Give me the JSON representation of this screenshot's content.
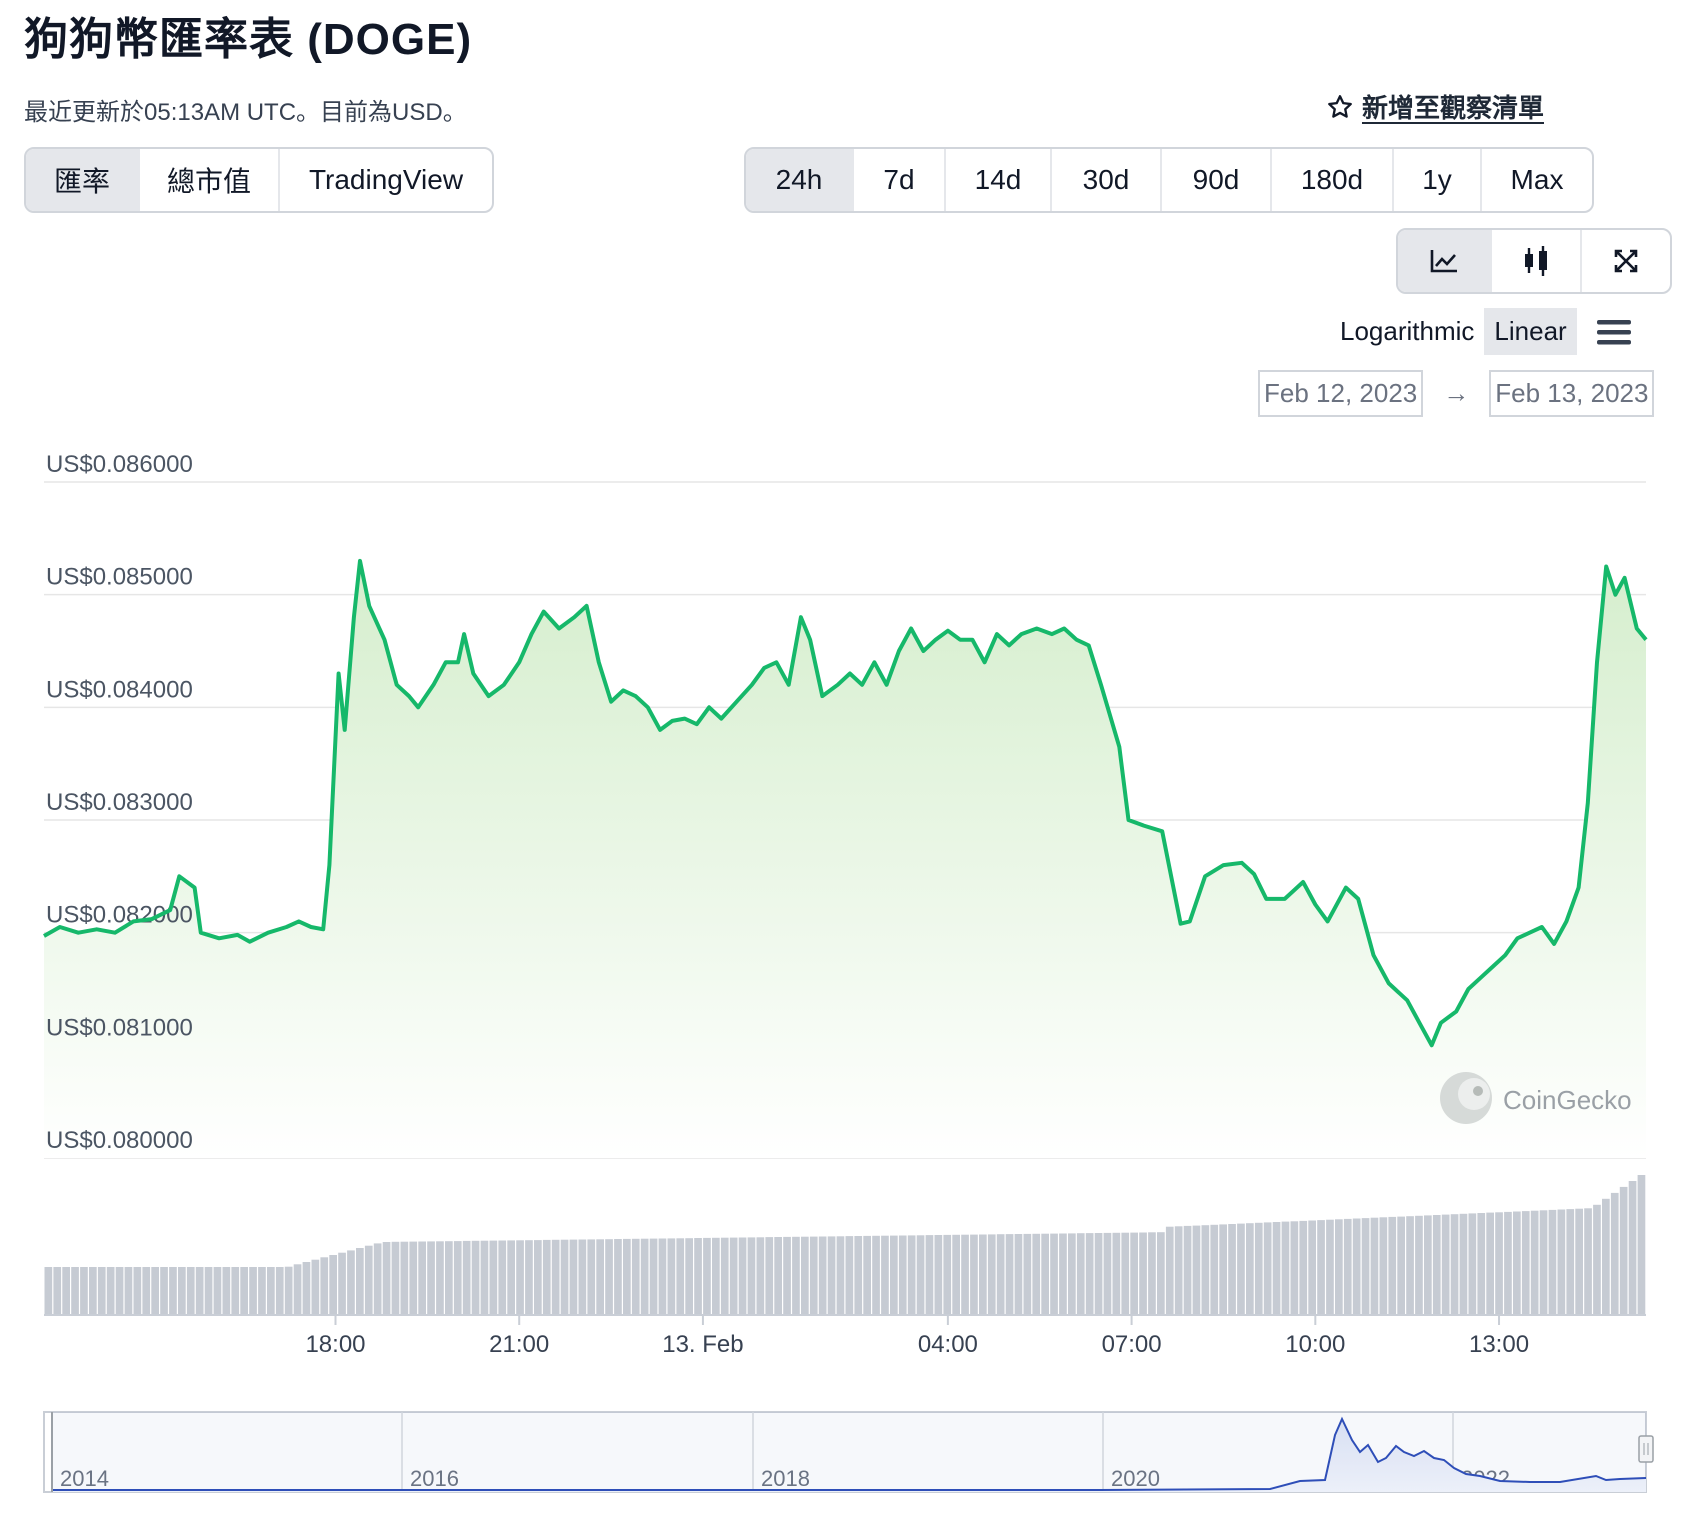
{
  "title": "狗狗幣匯率表 (DOGE)",
  "subtitle": "最近更新於05:13AM UTC。目前為USD。",
  "watchlist": {
    "label": "新增至觀察清單",
    "icon": "star-icon"
  },
  "view_tabs": [
    {
      "label": "匯率",
      "active": true
    },
    {
      "label": "總市值",
      "active": false
    },
    {
      "label": "TradingView",
      "active": false
    }
  ],
  "ranges": [
    {
      "label": "24h",
      "active": true
    },
    {
      "label": "7d",
      "active": false
    },
    {
      "label": "14d",
      "active": false
    },
    {
      "label": "30d",
      "active": false
    },
    {
      "label": "90d",
      "active": false
    },
    {
      "label": "180d",
      "active": false
    },
    {
      "label": "1y",
      "active": false
    },
    {
      "label": "Max",
      "active": false
    }
  ],
  "chart_types": [
    {
      "icon": "line-chart-icon",
      "active": true
    },
    {
      "icon": "candlestick-icon",
      "active": false
    },
    {
      "icon": "fullscreen-icon",
      "active": false
    }
  ],
  "scale": {
    "log_label": "Logarithmic",
    "linear_label": "Linear",
    "active": "Linear",
    "menu_icon": "hamburger-menu-icon"
  },
  "date_range": {
    "from": "Feb 12, 2023",
    "to": "Feb 13, 2023"
  },
  "colors": {
    "line": "#16b86a",
    "fill_top": "#d5eecd",
    "volume": "#c6cbd3",
    "navigator": "#2b4bb8",
    "grid": "#e6e6e6"
  },
  "chart_data": {
    "type": "area",
    "watermark": "CoinGecko",
    "y_ticks": [
      "US$0.086000",
      "US$0.085000",
      "US$0.084000",
      "US$0.083000",
      "US$0.082000",
      "US$0.081000",
      "US$0.080000"
    ],
    "ylim": [
      0.08,
      0.086
    ],
    "x_ticks": [
      "18:00",
      "21:00",
      "13. Feb",
      "04:00",
      "07:00",
      "10:00",
      "13:00"
    ],
    "x_tick_hours": [
      18,
      21,
      24,
      28,
      31,
      34,
      37
    ],
    "price_series": [
      [
        13.24,
        0.08197
      ],
      [
        13.5,
        0.08205
      ],
      [
        13.8,
        0.082
      ],
      [
        14.1,
        0.08203
      ],
      [
        14.4,
        0.082
      ],
      [
        14.7,
        0.0821
      ],
      [
        15.0,
        0.08212
      ],
      [
        15.3,
        0.0822
      ],
      [
        15.45,
        0.0825
      ],
      [
        15.7,
        0.0824
      ],
      [
        15.8,
        0.082
      ],
      [
        16.1,
        0.08195
      ],
      [
        16.4,
        0.08198
      ],
      [
        16.6,
        0.08192
      ],
      [
        16.9,
        0.082
      ],
      [
        17.2,
        0.08205
      ],
      [
        17.4,
        0.0821
      ],
      [
        17.6,
        0.08205
      ],
      [
        17.8,
        0.08203
      ],
      [
        17.9,
        0.0826
      ],
      [
        18.05,
        0.0843
      ],
      [
        18.15,
        0.0838
      ],
      [
        18.3,
        0.0848
      ],
      [
        18.4,
        0.0853
      ],
      [
        18.55,
        0.0849
      ],
      [
        18.8,
        0.0846
      ],
      [
        19.0,
        0.0842
      ],
      [
        19.2,
        0.0841
      ],
      [
        19.35,
        0.084
      ],
      [
        19.6,
        0.0842
      ],
      [
        19.8,
        0.0844
      ],
      [
        20.0,
        0.0844
      ],
      [
        20.1,
        0.08465
      ],
      [
        20.25,
        0.0843
      ],
      [
        20.5,
        0.0841
      ],
      [
        20.75,
        0.0842
      ],
      [
        21.0,
        0.0844
      ],
      [
        21.2,
        0.08465
      ],
      [
        21.4,
        0.08485
      ],
      [
        21.65,
        0.0847
      ],
      [
        21.9,
        0.0848
      ],
      [
        22.1,
        0.0849
      ],
      [
        22.3,
        0.0844
      ],
      [
        22.5,
        0.08405
      ],
      [
        22.7,
        0.08415
      ],
      [
        22.9,
        0.0841
      ],
      [
        23.1,
        0.084
      ],
      [
        23.3,
        0.0838
      ],
      [
        23.5,
        0.08388
      ],
      [
        23.7,
        0.0839
      ],
      [
        23.9,
        0.08385
      ],
      [
        24.1,
        0.084
      ],
      [
        24.3,
        0.0839
      ],
      [
        24.55,
        0.08405
      ],
      [
        24.8,
        0.0842
      ],
      [
        25.0,
        0.08435
      ],
      [
        25.2,
        0.0844
      ],
      [
        25.4,
        0.0842
      ],
      [
        25.6,
        0.0848
      ],
      [
        25.75,
        0.0846
      ],
      [
        25.95,
        0.0841
      ],
      [
        26.2,
        0.0842
      ],
      [
        26.4,
        0.0843
      ],
      [
        26.6,
        0.0842
      ],
      [
        26.8,
        0.0844
      ],
      [
        27.0,
        0.0842
      ],
      [
        27.2,
        0.0845
      ],
      [
        27.4,
        0.0847
      ],
      [
        27.6,
        0.0845
      ],
      [
        27.8,
        0.0846
      ],
      [
        28.0,
        0.08468
      ],
      [
        28.2,
        0.0846
      ],
      [
        28.4,
        0.0846
      ],
      [
        28.6,
        0.0844
      ],
      [
        28.8,
        0.08465
      ],
      [
        29.0,
        0.08455
      ],
      [
        29.2,
        0.08465
      ],
      [
        29.45,
        0.0847
      ],
      [
        29.7,
        0.08465
      ],
      [
        29.9,
        0.0847
      ],
      [
        30.1,
        0.0846
      ],
      [
        30.3,
        0.08455
      ],
      [
        30.5,
        0.0842
      ],
      [
        30.8,
        0.08365
      ],
      [
        30.95,
        0.083
      ],
      [
        31.2,
        0.08295
      ],
      [
        31.5,
        0.0829
      ],
      [
        31.8,
        0.08208
      ],
      [
        31.95,
        0.0821
      ],
      [
        32.2,
        0.0825
      ],
      [
        32.5,
        0.0826
      ],
      [
        32.8,
        0.08262
      ],
      [
        33.0,
        0.08252
      ],
      [
        33.2,
        0.0823
      ],
      [
        33.5,
        0.0823
      ],
      [
        33.8,
        0.08245
      ],
      [
        34.0,
        0.08225
      ],
      [
        34.2,
        0.0821
      ],
      [
        34.5,
        0.0824
      ],
      [
        34.7,
        0.0823
      ],
      [
        34.95,
        0.0818
      ],
      [
        35.2,
        0.08155
      ],
      [
        35.5,
        0.0814
      ],
      [
        35.7,
        0.0812
      ],
      [
        35.9,
        0.081
      ],
      [
        36.05,
        0.0812
      ],
      [
        36.3,
        0.0813
      ],
      [
        36.5,
        0.0815
      ],
      [
        36.7,
        0.0816
      ],
      [
        36.9,
        0.0817
      ],
      [
        37.1,
        0.0818
      ],
      [
        37.3,
        0.08195
      ],
      [
        37.5,
        0.082
      ],
      [
        37.7,
        0.08205
      ],
      [
        37.9,
        0.0819
      ],
      [
        38.1,
        0.0821
      ],
      [
        38.3,
        0.0824
      ],
      [
        38.45,
        0.08315
      ],
      [
        38.6,
        0.0844
      ],
      [
        38.75,
        0.08525
      ],
      [
        38.9,
        0.085
      ],
      [
        39.05,
        0.08515
      ],
      [
        39.25,
        0.0847
      ],
      [
        39.4,
        0.0846
      ]
    ],
    "navigator_x_ticks": [
      "2014",
      "2016",
      "2018",
      "2020",
      "2022"
    ]
  }
}
